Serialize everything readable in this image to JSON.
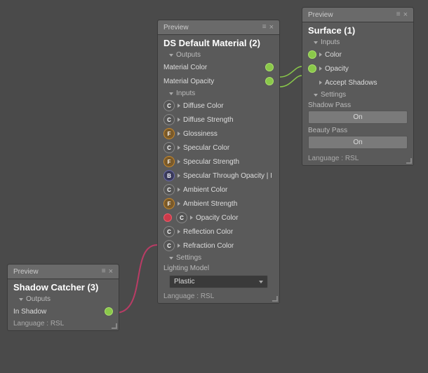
{
  "panels": {
    "ds_material": {
      "preview_label": "Preview",
      "title": "DS Default Material (2)",
      "outputs_label": "Outputs",
      "inputs_label": "Inputs",
      "settings_label": "Settings",
      "outputs": [
        {
          "label": "Material Color"
        },
        {
          "label": "Material Opacity"
        }
      ],
      "inputs": [
        {
          "badge": "C",
          "badge_type": "c",
          "label": "Diffuse Color"
        },
        {
          "badge": "C",
          "badge_type": "c",
          "label": "Diffuse Strength"
        },
        {
          "badge": "F",
          "badge_type": "f",
          "label": "Glossiness"
        },
        {
          "badge": "C",
          "badge_type": "c",
          "label": "Specular Color"
        },
        {
          "badge": "F",
          "badge_type": "f",
          "label": "Specular Strength"
        },
        {
          "badge": "B",
          "badge_type": "b",
          "label": "Specular Through Opacity | I"
        },
        {
          "badge": "C",
          "badge_type": "c",
          "label": "Ambient Color"
        },
        {
          "badge": "F",
          "badge_type": "f",
          "label": "Ambient Strength"
        },
        {
          "badge": "C",
          "badge_type": "c",
          "label": "Opacity Color",
          "connected": true
        },
        {
          "badge": "C",
          "badge_type": "c",
          "label": "Reflection Color"
        },
        {
          "badge": "C",
          "badge_type": "c",
          "label": "Refraction Color"
        }
      ],
      "settings": {
        "lighting_model_label": "Lighting Model",
        "dropdown_value": "Plastic"
      },
      "language_label": "Language : RSL"
    },
    "surface": {
      "preview_label": "Preview",
      "title": "Surface (1)",
      "inputs_label": "Inputs",
      "settings_label": "Settings",
      "inputs": [
        {
          "label": "Color"
        },
        {
          "label": "Opacity"
        },
        {
          "label": "Accept Shadows"
        }
      ],
      "settings": {
        "shadow_pass_label": "Shadow Pass",
        "shadow_pass_value": "On",
        "beauty_pass_label": "Beauty Pass",
        "beauty_pass_value": "On"
      },
      "language_label": "Language : RSL"
    },
    "shadow_catcher": {
      "preview_label": "Preview",
      "title": "Shadow Catcher (3)",
      "outputs_label": "Outputs",
      "outputs": [
        {
          "label": "In Shadow"
        }
      ],
      "language_label": "Language : RSL"
    }
  }
}
